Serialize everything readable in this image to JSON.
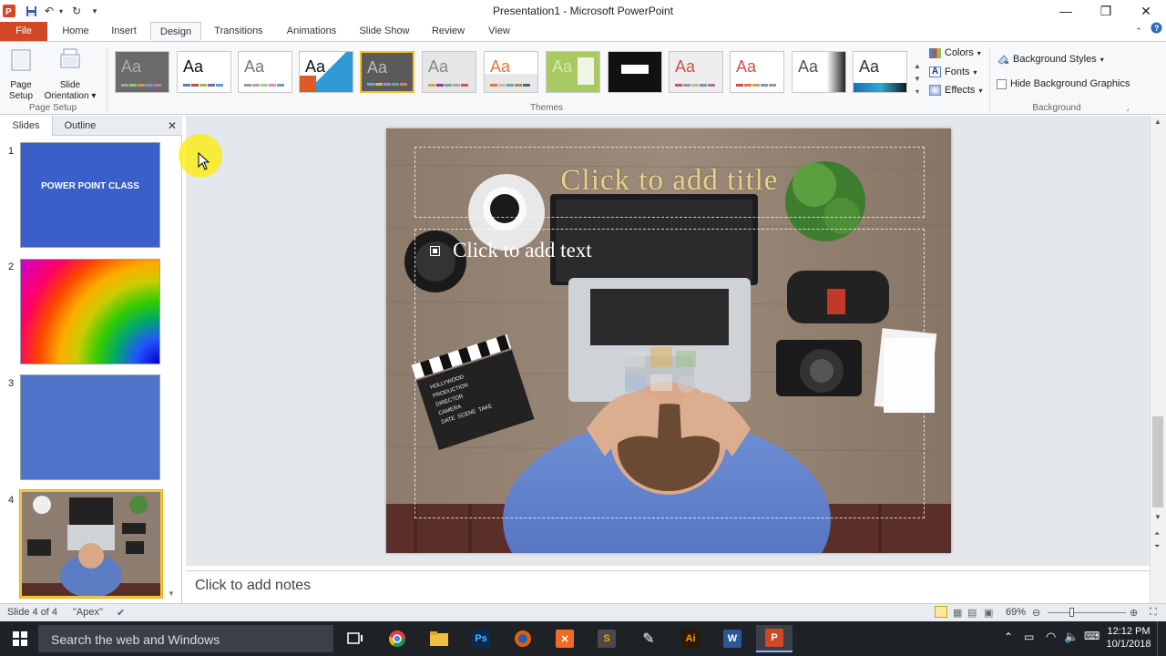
{
  "app": {
    "window_title": "Presentation1 - Microsoft PowerPoint"
  },
  "tabs": [
    {
      "label": "File"
    },
    {
      "label": "Home"
    },
    {
      "label": "Insert"
    },
    {
      "label": "Design"
    },
    {
      "label": "Transitions"
    },
    {
      "label": "Animations"
    },
    {
      "label": "Slide Show"
    },
    {
      "label": "Review"
    },
    {
      "label": "View"
    }
  ],
  "ribbon": {
    "page_setup": {
      "page_setup_label": "Page\nSetup",
      "slide_orientation_label": "Slide\nOrientation",
      "group_label": "Page Setup"
    },
    "themes": {
      "group_label": "Themes",
      "thumb_text": "Aa",
      "selected_index": 4
    },
    "theme_options": {
      "colors": "Colors",
      "fonts": "Fonts",
      "effects": "Effects"
    },
    "background": {
      "styles": "Background Styles",
      "hide_graphics": "Hide Background Graphics",
      "group_label": "Background"
    }
  },
  "left_pane": {
    "tab_slides": "Slides",
    "tab_outline": "Outline",
    "slides": [
      {
        "number": "1",
        "text": "POWER POINT CLASS"
      },
      {
        "number": "2",
        "text": ""
      },
      {
        "number": "3",
        "text": ""
      },
      {
        "number": "4",
        "text": ""
      }
    ]
  },
  "slide": {
    "title_placeholder": "Click to add title",
    "text_placeholder": "Click to add text",
    "clapper_text": [
      "HOLLYWOOD",
      "PRODUCTION",
      "DIRECTOR",
      "CAMERA",
      "DATE",
      "SCENE",
      "TAKE"
    ]
  },
  "notes": {
    "placeholder": "Click to add notes"
  },
  "status": {
    "slide_info": "Slide 4 of 4",
    "theme_name": "\"Apex\"",
    "zoom": "69%"
  },
  "taskbar": {
    "search_placeholder": "Search the web and Windows",
    "time": "12:12 PM",
    "date": "10/1/2018"
  },
  "colors": {
    "file_tab": "#d24726",
    "slide1_bg": "#3a5fc8",
    "slide3_bg": "#4f73c9",
    "selection": "#f4c542",
    "title_text": "#e8d08a"
  }
}
